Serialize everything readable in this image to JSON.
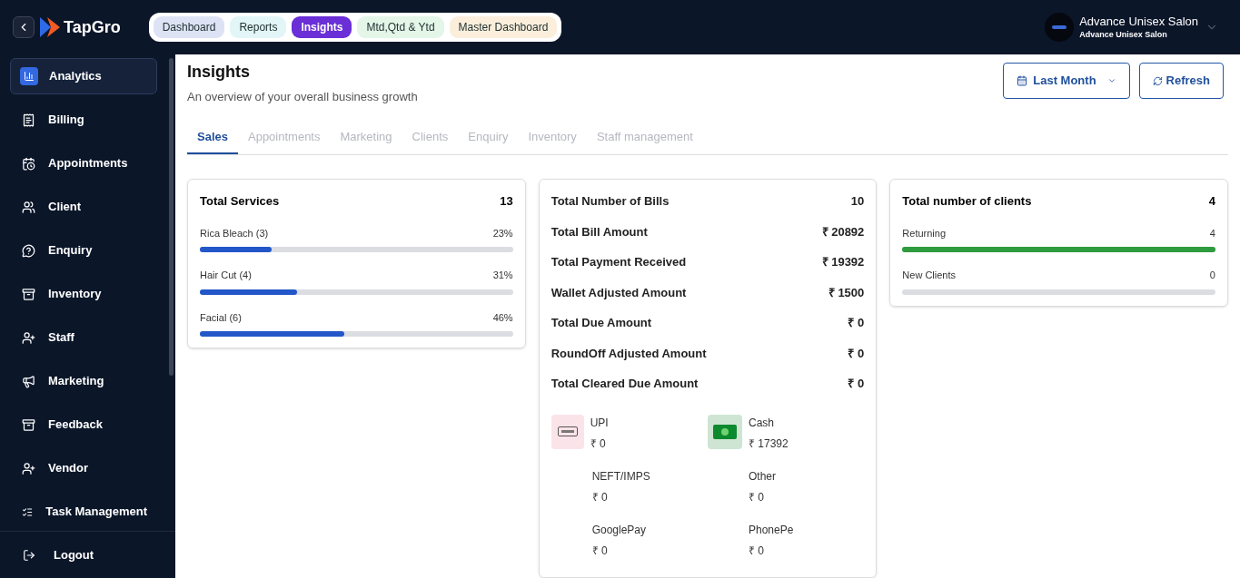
{
  "brand": {
    "name": "TapGro"
  },
  "nav_pills": [
    {
      "label": "Dashboard",
      "selected": false,
      "color": "#dde3f5"
    },
    {
      "label": "Reports",
      "selected": false,
      "color": "#e2f6f7"
    },
    {
      "label": "Insights",
      "selected": true,
      "color": "#6a2fd6"
    },
    {
      "label": "Mtd,Qtd & Ytd",
      "selected": false,
      "color": "#e3f6e8"
    },
    {
      "label": "Master Dashboard",
      "selected": false,
      "color": "#fbefdc"
    }
  ],
  "account": {
    "name": "Advance Unisex Salon",
    "subtitle": "Advance Unisex Salon"
  },
  "sidebar": {
    "items": [
      {
        "label": "Analytics",
        "kind": "chart",
        "selected": true
      },
      {
        "label": "Billing",
        "kind": "receipt",
        "selected": false
      },
      {
        "label": "Appointments",
        "kind": "calendar",
        "selected": false
      },
      {
        "label": "Client",
        "kind": "users",
        "selected": false
      },
      {
        "label": "Enquiry",
        "kind": "question",
        "selected": false
      },
      {
        "label": "Inventory",
        "kind": "box",
        "selected": false
      },
      {
        "label": "Staff",
        "kind": "user-plus",
        "selected": false
      },
      {
        "label": "Marketing",
        "kind": "megaphone",
        "selected": false
      },
      {
        "label": "Feedback",
        "kind": "box",
        "selected": false
      },
      {
        "label": "Vendor",
        "kind": "user-plus",
        "selected": false
      },
      {
        "label": "Task Management",
        "kind": "checklist",
        "selected": false
      }
    ],
    "logout": "Logout"
  },
  "page": {
    "title": "Insights",
    "subtitle": "An overview of your overall business growth",
    "period": "Last Month",
    "refresh": "Refresh"
  },
  "tabs": [
    {
      "label": "Sales",
      "selected": true
    },
    {
      "label": "Appointments",
      "selected": false
    },
    {
      "label": "Marketing",
      "selected": false
    },
    {
      "label": "Clients",
      "selected": false
    },
    {
      "label": "Enquiry",
      "selected": false
    },
    {
      "label": "Inventory",
      "selected": false
    },
    {
      "label": "Staff management",
      "selected": false
    }
  ],
  "services_card": {
    "title": "Total Services",
    "total": "13",
    "items": [
      {
        "name": "Rica Bleach (3)",
        "percent": "23%",
        "level": 0.23
      },
      {
        "name": "Hair Cut (4)",
        "percent": "31%",
        "level": 0.31
      },
      {
        "name": "Facial (6)",
        "percent": "46%",
        "level": 0.46
      }
    ]
  },
  "bills_card": {
    "rows": [
      {
        "label": "Total Number of Bills",
        "value": "10"
      },
      {
        "label": "Total Bill Amount",
        "value": "₹ 20892"
      },
      {
        "label": "Total Payment Received",
        "value": "₹ 19392"
      },
      {
        "label": "Wallet Adjusted Amount",
        "value": "₹ 1500"
      },
      {
        "label": "Total Due Amount",
        "value": "₹ 0"
      },
      {
        "label": "RoundOff Adjusted Amount",
        "value": "₹ 0"
      },
      {
        "label": "Total Cleared Due Amount",
        "value": "₹ 0"
      }
    ],
    "payments": [
      {
        "name": "UPI",
        "amount": "₹ 0",
        "kind": "upi"
      },
      {
        "name": "Cash",
        "amount": "₹ 17392",
        "kind": "cash"
      },
      {
        "name": "NEFT/IMPS",
        "amount": "₹ 0",
        "kind": "plain"
      },
      {
        "name": "Other",
        "amount": "₹ 0",
        "kind": "plain"
      },
      {
        "name": "GooglePay",
        "amount": "₹ 0",
        "kind": "plain"
      },
      {
        "name": "PhonePe",
        "amount": "₹ 0",
        "kind": "plain"
      }
    ]
  },
  "clients_card": {
    "title": "Total number of clients",
    "total": "4",
    "items": [
      {
        "name": "Returning",
        "count": "4",
        "level": 1
      },
      {
        "name": "New Clients",
        "count": "0",
        "level": 0
      }
    ]
  }
}
